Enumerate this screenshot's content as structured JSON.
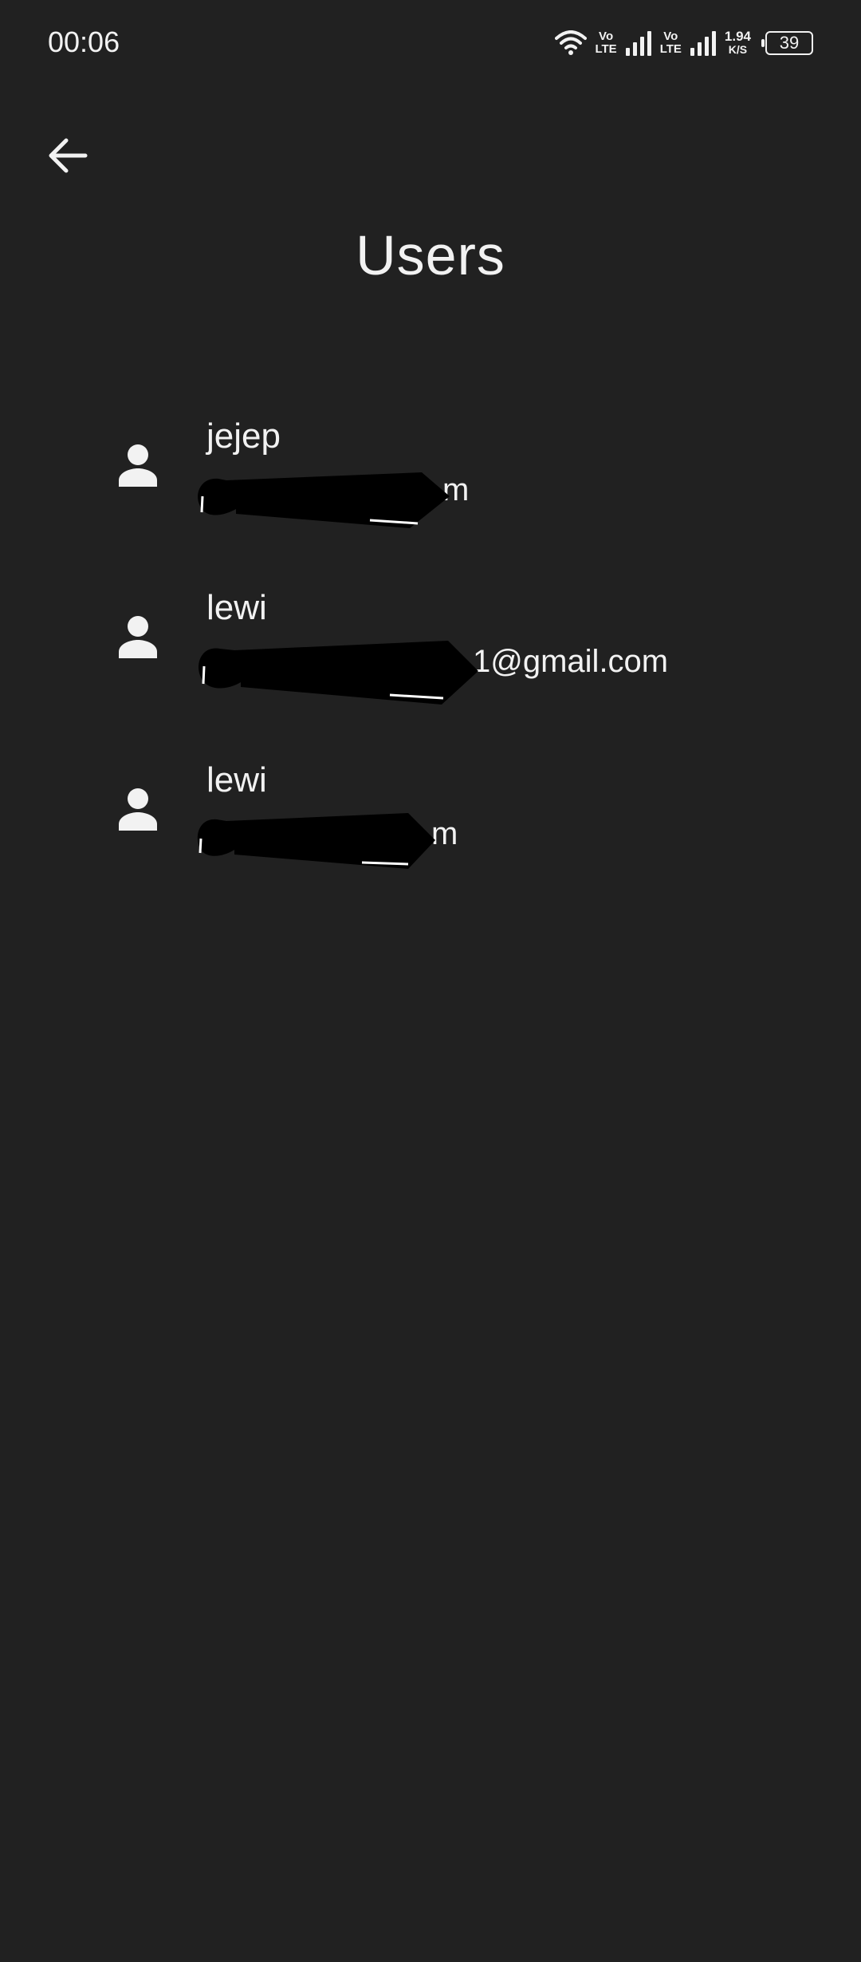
{
  "status_bar": {
    "time": "00:06",
    "volte_top": "Vo",
    "volte_bottom": "LTE",
    "speed_value": "1.94",
    "speed_unit": "K/S",
    "battery": "39",
    "icons": [
      "wifi-icon",
      "volte-icon",
      "signal-icon",
      "volte-icon",
      "signal-icon",
      "battery-icon"
    ]
  },
  "app_bar": {
    "back_icon": "arrow-left-icon",
    "title": "Users"
  },
  "users": [
    {
      "name": "jejep",
      "email_visible": "m",
      "email_redacted": true
    },
    {
      "name": "lewi",
      "email_visible": "1@gmail.com",
      "email_redacted": true
    },
    {
      "name": "lewi",
      "email_visible": "m",
      "email_redacted": true
    }
  ],
  "colors": {
    "background": "#212121",
    "text": "#f2f2f2",
    "redaction": "#000000"
  }
}
